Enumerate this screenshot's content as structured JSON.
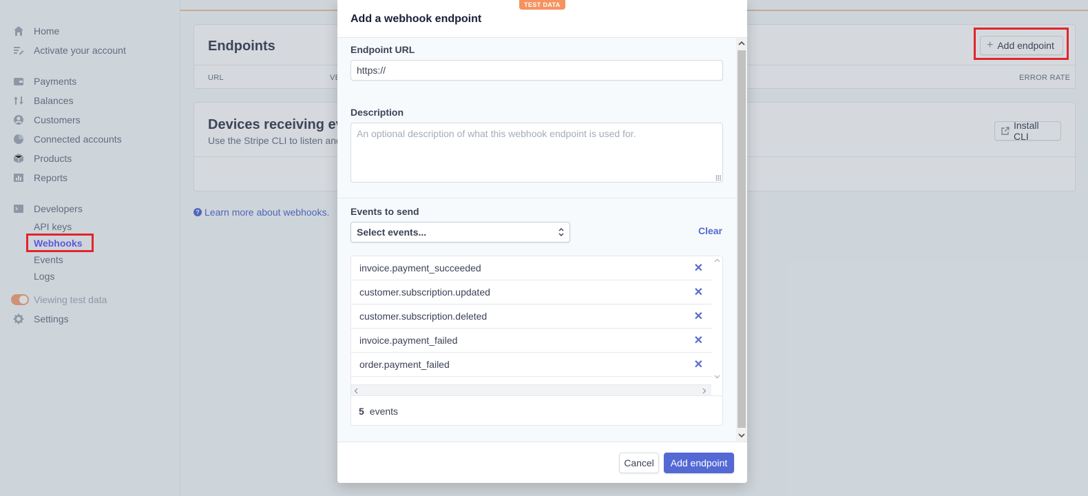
{
  "sidebar": {
    "items": [
      {
        "label": "Home",
        "icon": "home-icon"
      },
      {
        "label": "Activate your account",
        "icon": "edit-icon"
      },
      {
        "label": "Payments",
        "icon": "wallet-icon"
      },
      {
        "label": "Balances",
        "icon": "transfer-icon"
      },
      {
        "label": "Customers",
        "icon": "user-icon"
      },
      {
        "label": "Connected accounts",
        "icon": "globe-icon"
      },
      {
        "label": "Products",
        "icon": "box-icon"
      },
      {
        "label": "Reports",
        "icon": "chart-icon"
      },
      {
        "label": "Developers",
        "icon": "terminal-icon"
      }
    ],
    "developer_sub": [
      "API keys",
      "Webhooks",
      "Events",
      "Logs"
    ],
    "test_data_label": "Viewing test data",
    "settings_label": "Settings"
  },
  "page": {
    "endpoints_title": "Endpoints",
    "add_endpoint_label": "Add endpoint",
    "col_url": "URL",
    "col_ver": "VE",
    "col_error_rate": "ERROR RATE",
    "devices_title": "Devices receiving ev",
    "devices_sub": "Use the Stripe CLI to listen and",
    "install_cli_label": "Install CLI",
    "learn_more": "Learn more about webhooks."
  },
  "modal": {
    "badge": "TEST DATA",
    "title": "Add a webhook endpoint",
    "url_label": "Endpoint URL",
    "url_value": "https://",
    "description_label": "Description",
    "description_placeholder": "An optional description of what this webhook endpoint is used for.",
    "events_label": "Events to send",
    "select_placeholder": "Select events...",
    "clear_label": "Clear",
    "events": [
      "invoice.payment_succeeded",
      "customer.subscription.updated",
      "customer.subscription.deleted",
      "invoice.payment_failed",
      "order.payment_failed"
    ],
    "event_count": "5",
    "event_count_label": "events",
    "cancel_label": "Cancel",
    "submit_label": "Add endpoint"
  },
  "colors": {
    "accent": "#5469d4",
    "highlight": "#e0242c",
    "badge": "#f5925e"
  }
}
